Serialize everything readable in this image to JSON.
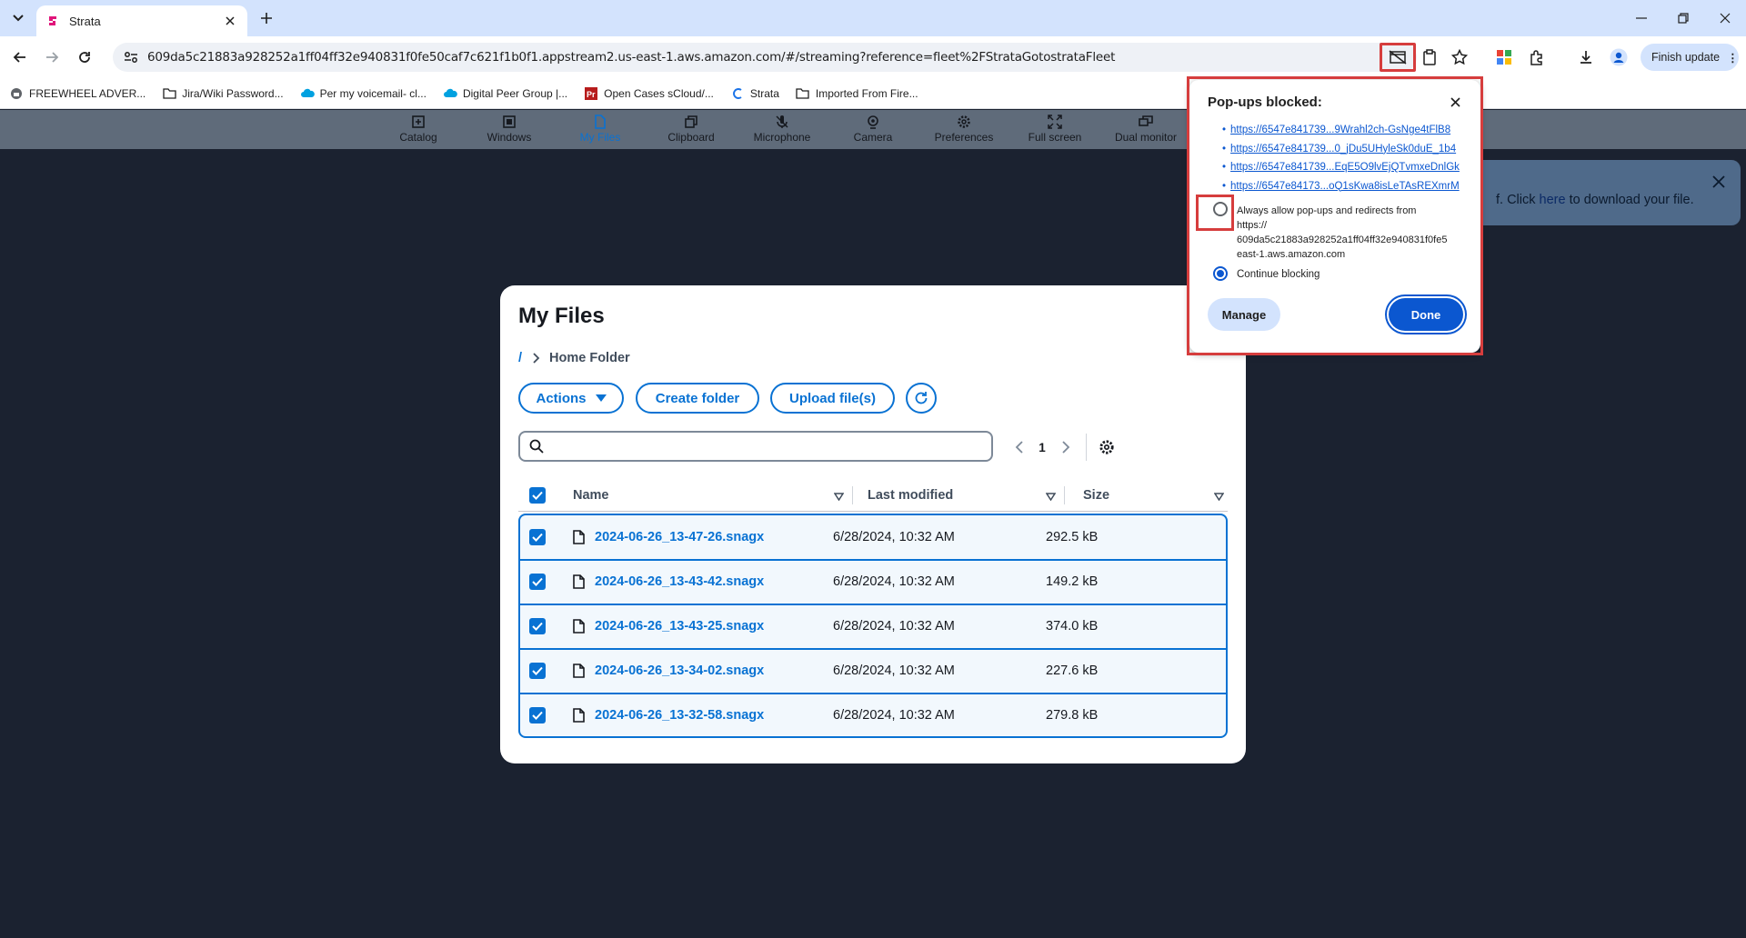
{
  "browser": {
    "tab_title": "Strata",
    "url": "609da5c21883a928252a1ff04ff32e940831f0fe50caf7c621f1b0f1.appstream2.us-east-1.aws.amazon.com/#/streaming?reference=fleet%2FStrataGotostrataFleet",
    "finish_update_label": "Finish update",
    "bookmarks": [
      {
        "label": "FREEWHEEL ADVER...",
        "icon": "site-icon"
      },
      {
        "label": "Jira/Wiki Password...",
        "icon": "folder-icon"
      },
      {
        "label": "Per my voicemail- cl...",
        "icon": "cloud-icon"
      },
      {
        "label": "Digital Peer Group |...",
        "icon": "cloud-icon"
      },
      {
        "label": "Open Cases sCloud/...",
        "icon": "pr-icon"
      },
      {
        "label": "Strata",
        "icon": "strata-icon"
      },
      {
        "label": "Imported From Fire...",
        "icon": "folder-icon"
      }
    ],
    "colors": {
      "chrome_blue": "#d3e3fd",
      "highlight_red": "#d63d3d"
    }
  },
  "appstream_toolbar": {
    "items": [
      {
        "label": "Catalog",
        "icon": "catalog-icon"
      },
      {
        "label": "Windows",
        "icon": "windows-icon"
      },
      {
        "label": "My Files",
        "icon": "files-icon",
        "active": true
      },
      {
        "label": "Clipboard",
        "icon": "clipboard-icon"
      },
      {
        "label": "Microphone",
        "icon": "microphone-icon"
      },
      {
        "label": "Camera",
        "icon": "camera-icon"
      },
      {
        "label": "Preferences",
        "icon": "gear-icon"
      },
      {
        "label": "Full screen",
        "icon": "fullscreen-icon"
      },
      {
        "label": "Dual monitor",
        "icon": "dual-monitor-icon"
      }
    ]
  },
  "banner": {
    "text_before": "f. Click ",
    "link": "here",
    "text_after": " to download your file."
  },
  "my_files": {
    "title": "My Files",
    "breadcrumb_root": "/",
    "breadcrumb_current": "Home Folder",
    "actions_label": "Actions",
    "create_folder_label": "Create folder",
    "upload_label": "Upload file(s)",
    "search_placeholder": "",
    "page_number": "1",
    "columns": {
      "name": "Name",
      "last_modified": "Last modified",
      "size": "Size"
    },
    "rows": [
      {
        "name": "2024-06-26_13-47-26.snagx",
        "modified": "6/28/2024, 10:32 AM",
        "size": "292.5 kB",
        "checked": true
      },
      {
        "name": "2024-06-26_13-43-42.snagx",
        "modified": "6/28/2024, 10:32 AM",
        "size": "149.2 kB",
        "checked": true
      },
      {
        "name": "2024-06-26_13-43-25.snagx",
        "modified": "6/28/2024, 10:32 AM",
        "size": "374.0 kB",
        "checked": true
      },
      {
        "name": "2024-06-26_13-34-02.snagx",
        "modified": "6/28/2024, 10:32 AM",
        "size": "227.6 kB",
        "checked": true
      },
      {
        "name": "2024-06-26_13-32-58.snagx",
        "modified": "6/28/2024, 10:32 AM",
        "size": "279.8 kB",
        "checked": true
      }
    ],
    "accent": "#0972d3"
  },
  "popup_bubble": {
    "title": "Pop-ups blocked:",
    "links": [
      "https://6547e841739...9Wrahl2ch-GsNge4tFlB8",
      "https://6547e841739...0_jDu5UHyleSk0duE_1b4",
      "https://6547e841739...EqE5O9lvEjQTvmxeDnlGk",
      "https://6547e84173...oQ1sKwa8isLeTAsREXmrM"
    ],
    "allow_option_lines": [
      "Always allow pop-ups and redirects from",
      "https://",
      "609da5c21883a928252a1ff04ff32e940831f0fe5",
      "east-1.aws.amazon.com"
    ],
    "block_option": "Continue blocking",
    "selected_option": "Continue blocking",
    "manage_label": "Manage",
    "done_label": "Done"
  }
}
